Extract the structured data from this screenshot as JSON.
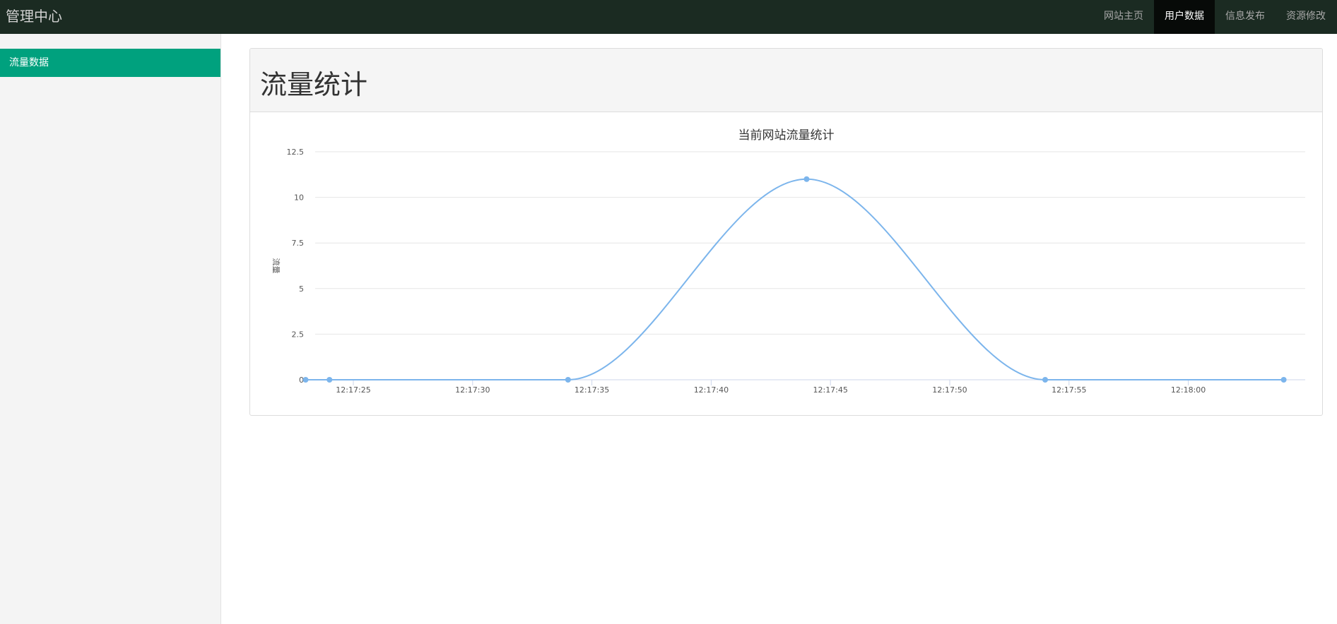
{
  "header": {
    "brand": "管理中心",
    "nav": [
      {
        "label": "网站主页",
        "active": false
      },
      {
        "label": "用户数据",
        "active": true
      },
      {
        "label": "信息发布",
        "active": false
      },
      {
        "label": "资源修改",
        "active": false
      }
    ]
  },
  "sidebar": {
    "items": [
      {
        "label": "流量数据",
        "active": true
      }
    ]
  },
  "panel": {
    "title": "流量统计"
  },
  "colors": {
    "topbar": "#1b2b22",
    "active_nav": "#070a08",
    "sidebar_active": "#00a17e",
    "series": "#7cb5ec"
  },
  "chart_data": {
    "type": "line",
    "title": "当前网站流量统计",
    "ylabel": "流量",
    "xlabel": "",
    "x_ticks": [
      "12:17:25",
      "12:17:30",
      "12:17:35",
      "12:17:40",
      "12:17:45",
      "12:17:50",
      "12:17:55",
      "12:18:00"
    ],
    "y_ticks": [
      "0",
      "2.5",
      "5",
      "7.5",
      "10",
      "12.5"
    ],
    "ylim": [
      0,
      12.5
    ],
    "xlim": [
      "12:17:23.4",
      "12:18:04.9"
    ],
    "grid": true,
    "smooth": true,
    "series": [
      {
        "x": [
          "12:17:23",
          "12:17:24",
          "12:17:34",
          "12:17:44",
          "12:17:54",
          "12:18:04"
        ],
        "values": [
          0,
          0,
          0,
          11,
          0,
          0
        ]
      }
    ]
  }
}
